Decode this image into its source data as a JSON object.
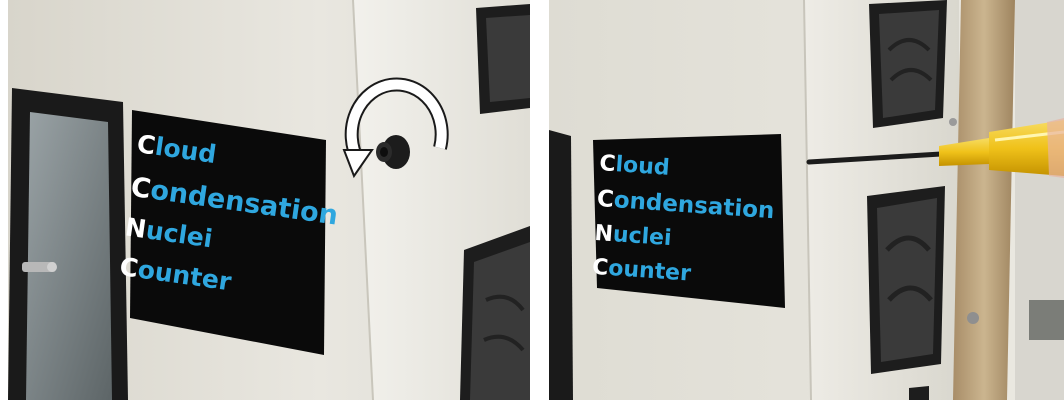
{
  "left_photo": {
    "label": [
      {
        "initial": "C",
        "rest": "loud"
      },
      {
        "initial": "C",
        "rest": "ondensation"
      },
      {
        "initial": "N",
        "rest": "uclei"
      },
      {
        "initial": "C",
        "rest": "ounter"
      }
    ],
    "arrow_icon": "counterclockwise-rotation-arrow-icon",
    "knob_icon": "thumbscrew-knob-icon"
  },
  "right_photo": {
    "label": [
      {
        "initial": "C",
        "rest": "loud"
      },
      {
        "initial": "C",
        "rest": "ondensation"
      },
      {
        "initial": "N",
        "rest": "uclei"
      },
      {
        "initial": "C",
        "rest": "ounter"
      }
    ],
    "tool_icon": "yellow-screwdriver-icon"
  },
  "colors": {
    "panel_white": "#e6e4dc",
    "label_black": "#0a0a0a",
    "label_blue": "#2fa7df",
    "label_white": "#ffffff",
    "screwdriver_yellow": "#f0c21a"
  }
}
